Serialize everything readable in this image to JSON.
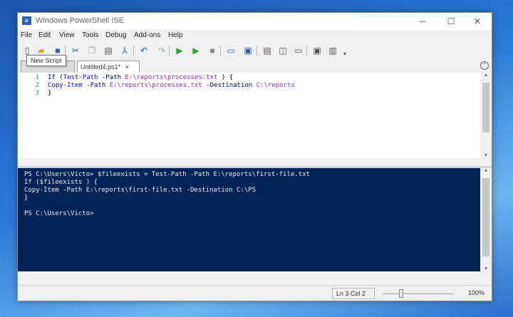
{
  "window": {
    "title": "Windows PowerShell ISE",
    "app_icon_glyph": "≥",
    "minimize_glyph": "─",
    "maximize_glyph": "☐",
    "close_glyph": "✕"
  },
  "menu": [
    "File",
    "Edit",
    "View",
    "Tools",
    "Debug",
    "Add-ons",
    "Help"
  ],
  "toolbar": {
    "icons": [
      {
        "name": "new-script-icon",
        "glyph": "▯",
        "color": "#555555"
      },
      {
        "name": "open-folder-icon",
        "glyph": "▰",
        "color": "#d9a520"
      },
      {
        "name": "save-icon",
        "glyph": "■",
        "color": "#2a5faf"
      },
      {
        "name": "cut-icon",
        "glyph": "✂",
        "color": "#2a5faf"
      },
      {
        "name": "copy-icon",
        "glyph": "❐",
        "color": "#aaaaaa"
      },
      {
        "name": "paste-icon",
        "glyph": "▤",
        "color": "#555555"
      },
      {
        "name": "clear-console-icon",
        "glyph": "⅄",
        "color": "#2a5faf"
      },
      {
        "name": "undo-icon",
        "glyph": "↶",
        "color": "#2a5faf"
      },
      {
        "name": "redo-icon",
        "glyph": "↷",
        "color": "#aaaaaa"
      },
      {
        "name": "run-script-icon",
        "glyph": "▶",
        "color": "#22aa22"
      },
      {
        "name": "run-selection-icon",
        "glyph": "▶",
        "color": "#22aa22"
      },
      {
        "name": "stop-icon",
        "glyph": "■",
        "color": "#888888"
      },
      {
        "name": "remote-powershell-icon",
        "glyph": "▭",
        "color": "#2a5faf"
      },
      {
        "name": "start-powershell-icon",
        "glyph": "▣",
        "color": "#2a5faf"
      },
      {
        "name": "show-script-pane-top-icon",
        "glyph": "▤",
        "color": "#555555"
      },
      {
        "name": "show-script-pane-right-icon",
        "glyph": "◫",
        "color": "#555555"
      },
      {
        "name": "show-script-pane-maximized-icon",
        "glyph": "▭",
        "color": "#555555"
      },
      {
        "name": "show-command-window-icon",
        "glyph": "▣",
        "color": "#555555"
      },
      {
        "name": "show-command-addon-icon",
        "glyph": "▥",
        "color": "#555555"
      },
      {
        "name": "toolbar-overflow-icon",
        "glyph": "▾",
        "color": "#555555"
      }
    ]
  },
  "tooltip": "New Script",
  "tabs": [
    {
      "label": "",
      "close": "×"
    },
    {
      "label": "Untitled4.ps1*",
      "close": "×"
    }
  ],
  "tabs_expand_glyph": "⌃",
  "editor": {
    "lines": [
      {
        "num": "1",
        "parts": [
          {
            "t": "If ",
            "c": "kw"
          },
          {
            "t": "(",
            "c": "plain"
          },
          {
            "t": "Test-Path",
            "c": "cmd"
          },
          {
            "t": " ",
            "c": "plain"
          },
          {
            "t": "-Path",
            "c": "param"
          },
          {
            "t": " ",
            "c": "plain"
          },
          {
            "t": "E:\\reports\\processes.txt",
            "c": "str"
          },
          {
            "t": " ) {",
            "c": "plain"
          }
        ]
      },
      {
        "num": "2",
        "parts": [
          {
            "t": "Copy-Item",
            "c": "cmd"
          },
          {
            "t": " ",
            "c": "plain"
          },
          {
            "t": "-Path",
            "c": "param"
          },
          {
            "t": " ",
            "c": "plain"
          },
          {
            "t": "E:\\reports\\processes.txt",
            "c": "str"
          },
          {
            "t": " ",
            "c": "plain"
          },
          {
            "t": "-Destination",
            "c": "param"
          },
          {
            "t": " ",
            "c": "plain"
          },
          {
            "t": "C:\\reports",
            "c": "str"
          }
        ]
      },
      {
        "num": "3",
        "parts": [
          {
            "t": "}",
            "c": "plain"
          }
        ]
      }
    ]
  },
  "console": {
    "lines": [
      "PS C:\\Users\\Victo> $fileexists = Test-Path -Path E:\\reports\\first-file.txt",
      "If ($fileexists ) {",
      "Copy-Item -Path E:\\reports\\first-file.txt -Destination C:\\PS",
      "}",
      "",
      "PS C:\\Users\\Victo>"
    ]
  },
  "status": {
    "position": "Ln 3  Col 2",
    "zoom": "100%"
  },
  "colors": {
    "console_bg": "#012456",
    "accent": "#2a65b5"
  }
}
